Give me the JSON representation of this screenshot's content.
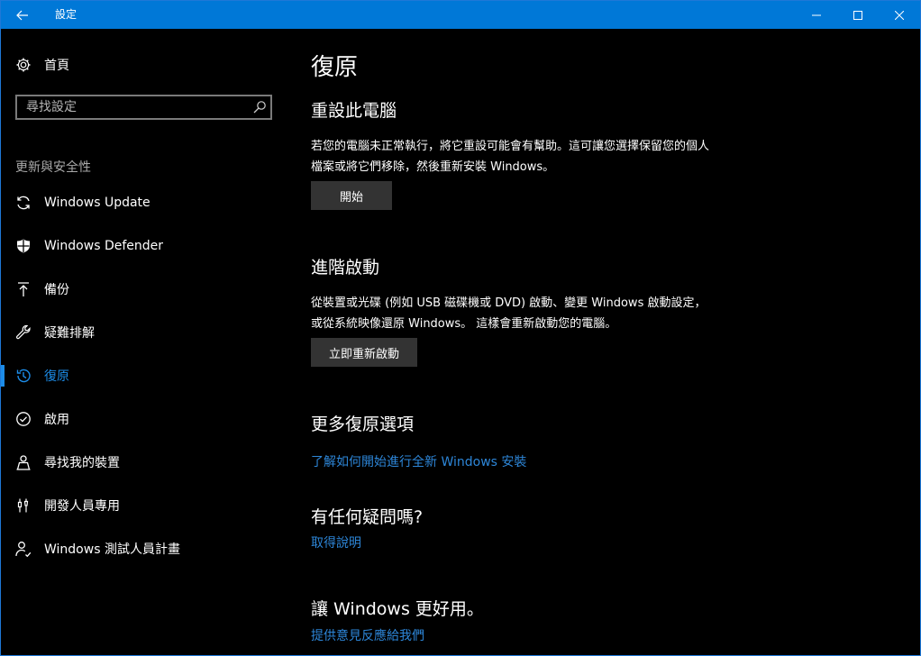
{
  "window": {
    "title": "設定"
  },
  "sidebar": {
    "home_label": "首頁",
    "search_placeholder": "尋找設定",
    "section_heading": "更新與安全性",
    "items": [
      {
        "label": "Windows Update",
        "icon": "sync-icon"
      },
      {
        "label": "Windows Defender",
        "icon": "shield-icon"
      },
      {
        "label": "備份",
        "icon": "backup-arrow-icon"
      },
      {
        "label": "疑難排解",
        "icon": "wrench-icon"
      },
      {
        "label": "復原",
        "icon": "history-icon",
        "active": true
      },
      {
        "label": "啟用",
        "icon": "check-circle-icon"
      },
      {
        "label": "尋找我的裝置",
        "icon": "person-location-icon"
      },
      {
        "label": "開發人員專用",
        "icon": "developer-tools-icon"
      },
      {
        "label": "Windows 測試人員計畫",
        "icon": "insider-person-icon"
      }
    ]
  },
  "main": {
    "title": "復原",
    "reset": {
      "heading": "重設此電腦",
      "description": "若您的電腦未正常執行，將它重設可能會有幫助。這可讓您選擇保留您的個人檔案或將它們移除，然後重新安裝 Windows。",
      "button": "開始"
    },
    "advanced": {
      "heading": "進階啟動",
      "description": "從裝置或光碟 (例如 USB 磁碟機或 DVD) 啟動、變更 Windows 啟動設定，或從系統映像還原 Windows。 這樣會重新啟動您的電腦。",
      "button": "立即重新啟動"
    },
    "more": {
      "heading": "更多復原選項",
      "link": "了解如何開始進行全新 Windows 安裝"
    },
    "questions": {
      "heading": "有任何疑問嗎?",
      "link": "取得說明"
    },
    "feedback": {
      "heading": "讓 Windows 更好用。",
      "link": "提供意見反應給我們"
    }
  },
  "colors": {
    "titlebar": "#0078d7",
    "accent": "#1c8ce8",
    "link": "#2d86d8",
    "button": "#333333"
  }
}
